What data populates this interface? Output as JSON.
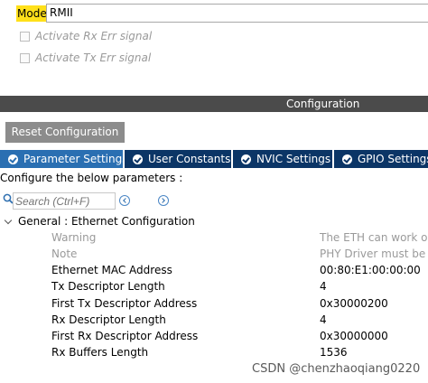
{
  "mode": {
    "label": "Mode",
    "value": "RMII"
  },
  "options": [
    {
      "label": "Activate Rx Err signal"
    },
    {
      "label": "Activate Tx Err signal"
    }
  ],
  "config_bar": {
    "title": "Configuration"
  },
  "reset_button": {
    "label": "Reset Configuration"
  },
  "tabs": [
    {
      "label": "Parameter Settings",
      "icon": "check-circle-icon"
    },
    {
      "label": "User Constants",
      "icon": "check-circle-icon"
    },
    {
      "label": "NVIC Settings",
      "icon": "check-circle-icon"
    },
    {
      "label": "GPIO Settings",
      "icon": "check-circle-icon"
    }
  ],
  "params_label": "Configure the below parameters :",
  "search": {
    "placeholder": "Search (Ctrl+F)"
  },
  "group": {
    "title": "General : Ethernet Configuration"
  },
  "parameters": [
    {
      "name": "Warning",
      "value": "The ETH can work only"
    },
    {
      "name": "Note",
      "value": "PHY Driver must be co"
    },
    {
      "name": "Ethernet MAC Address",
      "value": "00:80:E1:00:00:00"
    },
    {
      "name": "Tx Descriptor Length",
      "value": "4"
    },
    {
      "name": "First Tx Descriptor Address",
      "value": "0x30000200"
    },
    {
      "name": "Rx Descriptor Length",
      "value": "4"
    },
    {
      "name": "First Rx Descriptor Address",
      "value": "0x30000000"
    },
    {
      "name": "Rx Buffers Length",
      "value": "1536"
    }
  ],
  "watermark": "CSDN @chenzhaoqiang0220",
  "colors": {
    "highlight": "#ffe01a",
    "tab_active": "#2a6fb2",
    "tab_inactive": "#0b3566",
    "config_bar": "#4b4b4b",
    "reset_button": "#8c8c8c"
  }
}
